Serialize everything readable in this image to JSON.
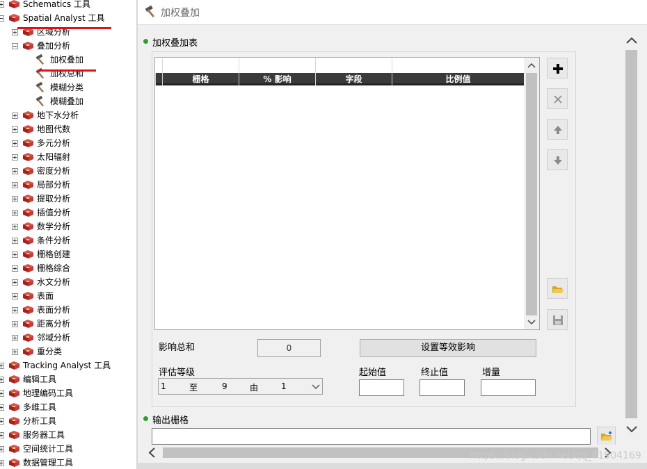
{
  "tree": {
    "items": [
      {
        "label": "Schematics 工具",
        "level": 0,
        "icon": "toolbox-icon",
        "expander": "plus"
      },
      {
        "label": "Spatial Analyst 工具",
        "level": 0,
        "icon": "toolbox-icon",
        "expander": "minus"
      },
      {
        "label": "区域分析",
        "level": 1,
        "icon": "toolbox-icon",
        "expander": "plus"
      },
      {
        "label": "叠加分析",
        "level": 1,
        "icon": "toolbox-icon",
        "expander": "minus"
      },
      {
        "label": "加权叠加",
        "level": 2,
        "icon": "hammer-icon",
        "expander": "none"
      },
      {
        "label": "加权总和",
        "level": 2,
        "icon": "hammer-icon",
        "expander": "none"
      },
      {
        "label": "模糊分类",
        "level": 2,
        "icon": "hammer-icon",
        "expander": "none"
      },
      {
        "label": "模糊叠加",
        "level": 2,
        "icon": "hammer-icon",
        "expander": "none"
      },
      {
        "label": "地下水分析",
        "level": 1,
        "icon": "toolbox-icon",
        "expander": "plus"
      },
      {
        "label": "地图代数",
        "level": 1,
        "icon": "toolbox-icon",
        "expander": "plus"
      },
      {
        "label": "多元分析",
        "level": 1,
        "icon": "toolbox-icon",
        "expander": "plus"
      },
      {
        "label": "太阳辐射",
        "level": 1,
        "icon": "toolbox-icon",
        "expander": "plus"
      },
      {
        "label": "密度分析",
        "level": 1,
        "icon": "toolbox-icon",
        "expander": "plus"
      },
      {
        "label": "局部分析",
        "level": 1,
        "icon": "toolbox-icon",
        "expander": "plus"
      },
      {
        "label": "提取分析",
        "level": 1,
        "icon": "toolbox-icon",
        "expander": "plus"
      },
      {
        "label": "插值分析",
        "level": 1,
        "icon": "toolbox-icon",
        "expander": "plus"
      },
      {
        "label": "数学分析",
        "level": 1,
        "icon": "toolbox-icon",
        "expander": "plus"
      },
      {
        "label": "条件分析",
        "level": 1,
        "icon": "toolbox-icon",
        "expander": "plus"
      },
      {
        "label": "栅格创建",
        "level": 1,
        "icon": "toolbox-icon",
        "expander": "plus"
      },
      {
        "label": "栅格综合",
        "level": 1,
        "icon": "toolbox-icon",
        "expander": "plus"
      },
      {
        "label": "水文分析",
        "level": 1,
        "icon": "toolbox-icon",
        "expander": "plus"
      },
      {
        "label": "表面",
        "level": 1,
        "icon": "toolbox-icon",
        "expander": "plus"
      },
      {
        "label": "表面分析",
        "level": 1,
        "icon": "toolbox-icon",
        "expander": "plus"
      },
      {
        "label": "距离分析",
        "level": 1,
        "icon": "toolbox-icon",
        "expander": "plus"
      },
      {
        "label": "邻域分析",
        "level": 1,
        "icon": "toolbox-icon",
        "expander": "plus"
      },
      {
        "label": "重分类",
        "level": 1,
        "icon": "toolbox-icon",
        "expander": "plus"
      },
      {
        "label": "Tracking Analyst 工具",
        "level": 0,
        "icon": "toolbox-icon",
        "expander": "plus"
      },
      {
        "label": "编辑工具",
        "level": 0,
        "icon": "toolbox-icon",
        "expander": "plus"
      },
      {
        "label": "地理编码工具",
        "level": 0,
        "icon": "toolbox-icon",
        "expander": "plus"
      },
      {
        "label": "多维工具",
        "level": 0,
        "icon": "toolbox-icon",
        "expander": "plus"
      },
      {
        "label": "分析工具",
        "level": 0,
        "icon": "toolbox-icon",
        "expander": "plus"
      },
      {
        "label": "服务器工具",
        "level": 0,
        "icon": "toolbox-icon",
        "expander": "plus"
      },
      {
        "label": "空间统计工具",
        "level": 0,
        "icon": "toolbox-icon",
        "expander": "plus"
      },
      {
        "label": "数据管理工具",
        "level": 0,
        "icon": "toolbox-icon",
        "expander": "plus"
      }
    ]
  },
  "dialog": {
    "title": "加权叠加",
    "table_section": "加权叠加表",
    "columns": [
      "栅格",
      "% 影响",
      "字段",
      "比例值"
    ],
    "influence_sum_label": "影响总和",
    "influence_sum_value": "0",
    "equal_influence_button": "设置等效影响",
    "eval_scale_label": "评估等级",
    "eval_scale": {
      "from": "1",
      "to_word": "至",
      "to": "9",
      "by_word": "由",
      "by": "1"
    },
    "from_label": "起始值",
    "to_label": "终止值",
    "increment_label": "增量",
    "output_section": "输出栅格"
  },
  "watermark": "https://blog.csdn.net/qq_41904169",
  "colors": {
    "annotation_red": "#e0101a",
    "required_dot": "#2ca02c",
    "header_dark": "#3a3a3a"
  }
}
